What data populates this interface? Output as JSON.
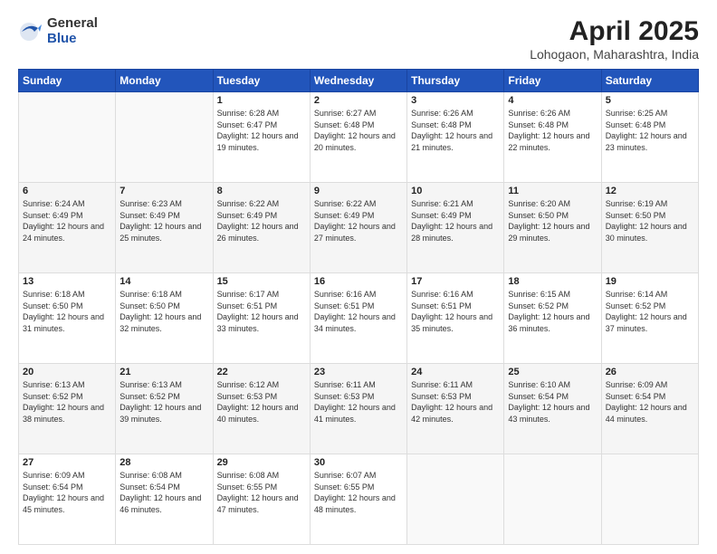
{
  "logo": {
    "general": "General",
    "blue": "Blue"
  },
  "title": {
    "month": "April 2025",
    "location": "Lohogaon, Maharashtra, India"
  },
  "days_header": [
    "Sunday",
    "Monday",
    "Tuesday",
    "Wednesday",
    "Thursday",
    "Friday",
    "Saturday"
  ],
  "weeks": [
    [
      {
        "day": "",
        "sunrise": "",
        "sunset": "",
        "daylight": ""
      },
      {
        "day": "",
        "sunrise": "",
        "sunset": "",
        "daylight": ""
      },
      {
        "day": "1",
        "sunrise": "Sunrise: 6:28 AM",
        "sunset": "Sunset: 6:47 PM",
        "daylight": "Daylight: 12 hours and 19 minutes."
      },
      {
        "day": "2",
        "sunrise": "Sunrise: 6:27 AM",
        "sunset": "Sunset: 6:48 PM",
        "daylight": "Daylight: 12 hours and 20 minutes."
      },
      {
        "day": "3",
        "sunrise": "Sunrise: 6:26 AM",
        "sunset": "Sunset: 6:48 PM",
        "daylight": "Daylight: 12 hours and 21 minutes."
      },
      {
        "day": "4",
        "sunrise": "Sunrise: 6:26 AM",
        "sunset": "Sunset: 6:48 PM",
        "daylight": "Daylight: 12 hours and 22 minutes."
      },
      {
        "day": "5",
        "sunrise": "Sunrise: 6:25 AM",
        "sunset": "Sunset: 6:48 PM",
        "daylight": "Daylight: 12 hours and 23 minutes."
      }
    ],
    [
      {
        "day": "6",
        "sunrise": "Sunrise: 6:24 AM",
        "sunset": "Sunset: 6:49 PM",
        "daylight": "Daylight: 12 hours and 24 minutes."
      },
      {
        "day": "7",
        "sunrise": "Sunrise: 6:23 AM",
        "sunset": "Sunset: 6:49 PM",
        "daylight": "Daylight: 12 hours and 25 minutes."
      },
      {
        "day": "8",
        "sunrise": "Sunrise: 6:22 AM",
        "sunset": "Sunset: 6:49 PM",
        "daylight": "Daylight: 12 hours and 26 minutes."
      },
      {
        "day": "9",
        "sunrise": "Sunrise: 6:22 AM",
        "sunset": "Sunset: 6:49 PM",
        "daylight": "Daylight: 12 hours and 27 minutes."
      },
      {
        "day": "10",
        "sunrise": "Sunrise: 6:21 AM",
        "sunset": "Sunset: 6:49 PM",
        "daylight": "Daylight: 12 hours and 28 minutes."
      },
      {
        "day": "11",
        "sunrise": "Sunrise: 6:20 AM",
        "sunset": "Sunset: 6:50 PM",
        "daylight": "Daylight: 12 hours and 29 minutes."
      },
      {
        "day": "12",
        "sunrise": "Sunrise: 6:19 AM",
        "sunset": "Sunset: 6:50 PM",
        "daylight": "Daylight: 12 hours and 30 minutes."
      }
    ],
    [
      {
        "day": "13",
        "sunrise": "Sunrise: 6:18 AM",
        "sunset": "Sunset: 6:50 PM",
        "daylight": "Daylight: 12 hours and 31 minutes."
      },
      {
        "day": "14",
        "sunrise": "Sunrise: 6:18 AM",
        "sunset": "Sunset: 6:50 PM",
        "daylight": "Daylight: 12 hours and 32 minutes."
      },
      {
        "day": "15",
        "sunrise": "Sunrise: 6:17 AM",
        "sunset": "Sunset: 6:51 PM",
        "daylight": "Daylight: 12 hours and 33 minutes."
      },
      {
        "day": "16",
        "sunrise": "Sunrise: 6:16 AM",
        "sunset": "Sunset: 6:51 PM",
        "daylight": "Daylight: 12 hours and 34 minutes."
      },
      {
        "day": "17",
        "sunrise": "Sunrise: 6:16 AM",
        "sunset": "Sunset: 6:51 PM",
        "daylight": "Daylight: 12 hours and 35 minutes."
      },
      {
        "day": "18",
        "sunrise": "Sunrise: 6:15 AM",
        "sunset": "Sunset: 6:52 PM",
        "daylight": "Daylight: 12 hours and 36 minutes."
      },
      {
        "day": "19",
        "sunrise": "Sunrise: 6:14 AM",
        "sunset": "Sunset: 6:52 PM",
        "daylight": "Daylight: 12 hours and 37 minutes."
      }
    ],
    [
      {
        "day": "20",
        "sunrise": "Sunrise: 6:13 AM",
        "sunset": "Sunset: 6:52 PM",
        "daylight": "Daylight: 12 hours and 38 minutes."
      },
      {
        "day": "21",
        "sunrise": "Sunrise: 6:13 AM",
        "sunset": "Sunset: 6:52 PM",
        "daylight": "Daylight: 12 hours and 39 minutes."
      },
      {
        "day": "22",
        "sunrise": "Sunrise: 6:12 AM",
        "sunset": "Sunset: 6:53 PM",
        "daylight": "Daylight: 12 hours and 40 minutes."
      },
      {
        "day": "23",
        "sunrise": "Sunrise: 6:11 AM",
        "sunset": "Sunset: 6:53 PM",
        "daylight": "Daylight: 12 hours and 41 minutes."
      },
      {
        "day": "24",
        "sunrise": "Sunrise: 6:11 AM",
        "sunset": "Sunset: 6:53 PM",
        "daylight": "Daylight: 12 hours and 42 minutes."
      },
      {
        "day": "25",
        "sunrise": "Sunrise: 6:10 AM",
        "sunset": "Sunset: 6:54 PM",
        "daylight": "Daylight: 12 hours and 43 minutes."
      },
      {
        "day": "26",
        "sunrise": "Sunrise: 6:09 AM",
        "sunset": "Sunset: 6:54 PM",
        "daylight": "Daylight: 12 hours and 44 minutes."
      }
    ],
    [
      {
        "day": "27",
        "sunrise": "Sunrise: 6:09 AM",
        "sunset": "Sunset: 6:54 PM",
        "daylight": "Daylight: 12 hours and 45 minutes."
      },
      {
        "day": "28",
        "sunrise": "Sunrise: 6:08 AM",
        "sunset": "Sunset: 6:54 PM",
        "daylight": "Daylight: 12 hours and 46 minutes."
      },
      {
        "day": "29",
        "sunrise": "Sunrise: 6:08 AM",
        "sunset": "Sunset: 6:55 PM",
        "daylight": "Daylight: 12 hours and 47 minutes."
      },
      {
        "day": "30",
        "sunrise": "Sunrise: 6:07 AM",
        "sunset": "Sunset: 6:55 PM",
        "daylight": "Daylight: 12 hours and 48 minutes."
      },
      {
        "day": "",
        "sunrise": "",
        "sunset": "",
        "daylight": ""
      },
      {
        "day": "",
        "sunrise": "",
        "sunset": "",
        "daylight": ""
      },
      {
        "day": "",
        "sunrise": "",
        "sunset": "",
        "daylight": ""
      }
    ]
  ]
}
